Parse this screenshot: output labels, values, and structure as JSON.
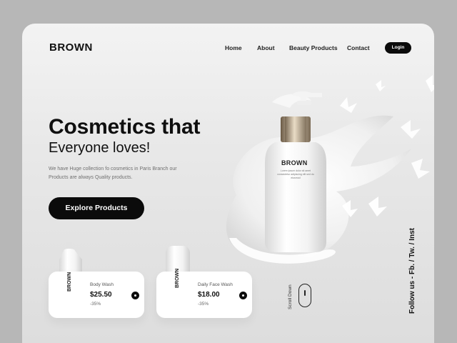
{
  "brand": "BROWN",
  "nav": {
    "items": [
      {
        "label": "Home"
      },
      {
        "label": "About"
      },
      {
        "label": "Beauty Products"
      },
      {
        "label": "Contact"
      }
    ],
    "login_label": "Login"
  },
  "hero": {
    "title_line1": "Cosmetics that",
    "title_line2": "Everyone loves!",
    "description": "We have Huge collection fo cosmetics in Paris Branch our Products are always Quality products.",
    "cta_label": "Explore Products",
    "bottle_brand": "BROWN",
    "bottle_text": "Lorem ipsum dolor sit amet consectetur adipiscing elit sed do eiusmod"
  },
  "products": [
    {
      "name": "Body Wash",
      "price": "$25.50",
      "discount": "-35%",
      "bottle_brand": "BROWN"
    },
    {
      "name": "Daily Face Wash",
      "price": "$18.00",
      "discount": "-35%",
      "bottle_brand": "BROWN"
    }
  ],
  "scroll_label": "Scroll Down",
  "social": "Follow us -  Fb.  /  Tw.  /  Inst",
  "colors": {
    "background": "#b7b7b7",
    "accent": "#0b0b0b",
    "card": "#ffffff"
  },
  "icons": [
    "mouse-scroll-icon",
    "cart-dot-icon",
    "butterfly-icon"
  ]
}
